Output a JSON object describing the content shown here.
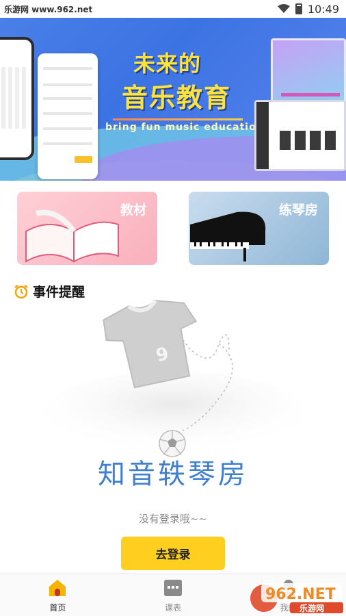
{
  "status_bar": {
    "source_label": "乐游网 www.962.net",
    "time": "10:49"
  },
  "banner": {
    "title_line1": "未来的",
    "title_line2": "音乐教育",
    "subtitle": "bring fun music education"
  },
  "categories": [
    {
      "label": "教材",
      "icon": "open-book"
    },
    {
      "label": "练琴房",
      "icon": "grand-piano"
    }
  ],
  "reminder": {
    "title": "事件提醒",
    "icon": "alarm-clock-icon"
  },
  "empty_state": {
    "brand": "知音轶琴房",
    "message": "没有登录哦~~",
    "login_button": "去登录",
    "jersey_number": "9"
  },
  "bottom_nav": [
    {
      "label": "首页",
      "icon": "home-icon",
      "active": true
    },
    {
      "label": "课表",
      "icon": "schedule-icon",
      "active": false
    },
    {
      "label": "我的",
      "icon": "profile-icon",
      "active": false
    }
  ],
  "watermark": {
    "logo_text": "962.NET",
    "site_name": "乐游网"
  },
  "colors": {
    "accent": "#ffcf1f",
    "banner_blue": "#3c73e3",
    "brand_text": "#3e7fd0"
  }
}
